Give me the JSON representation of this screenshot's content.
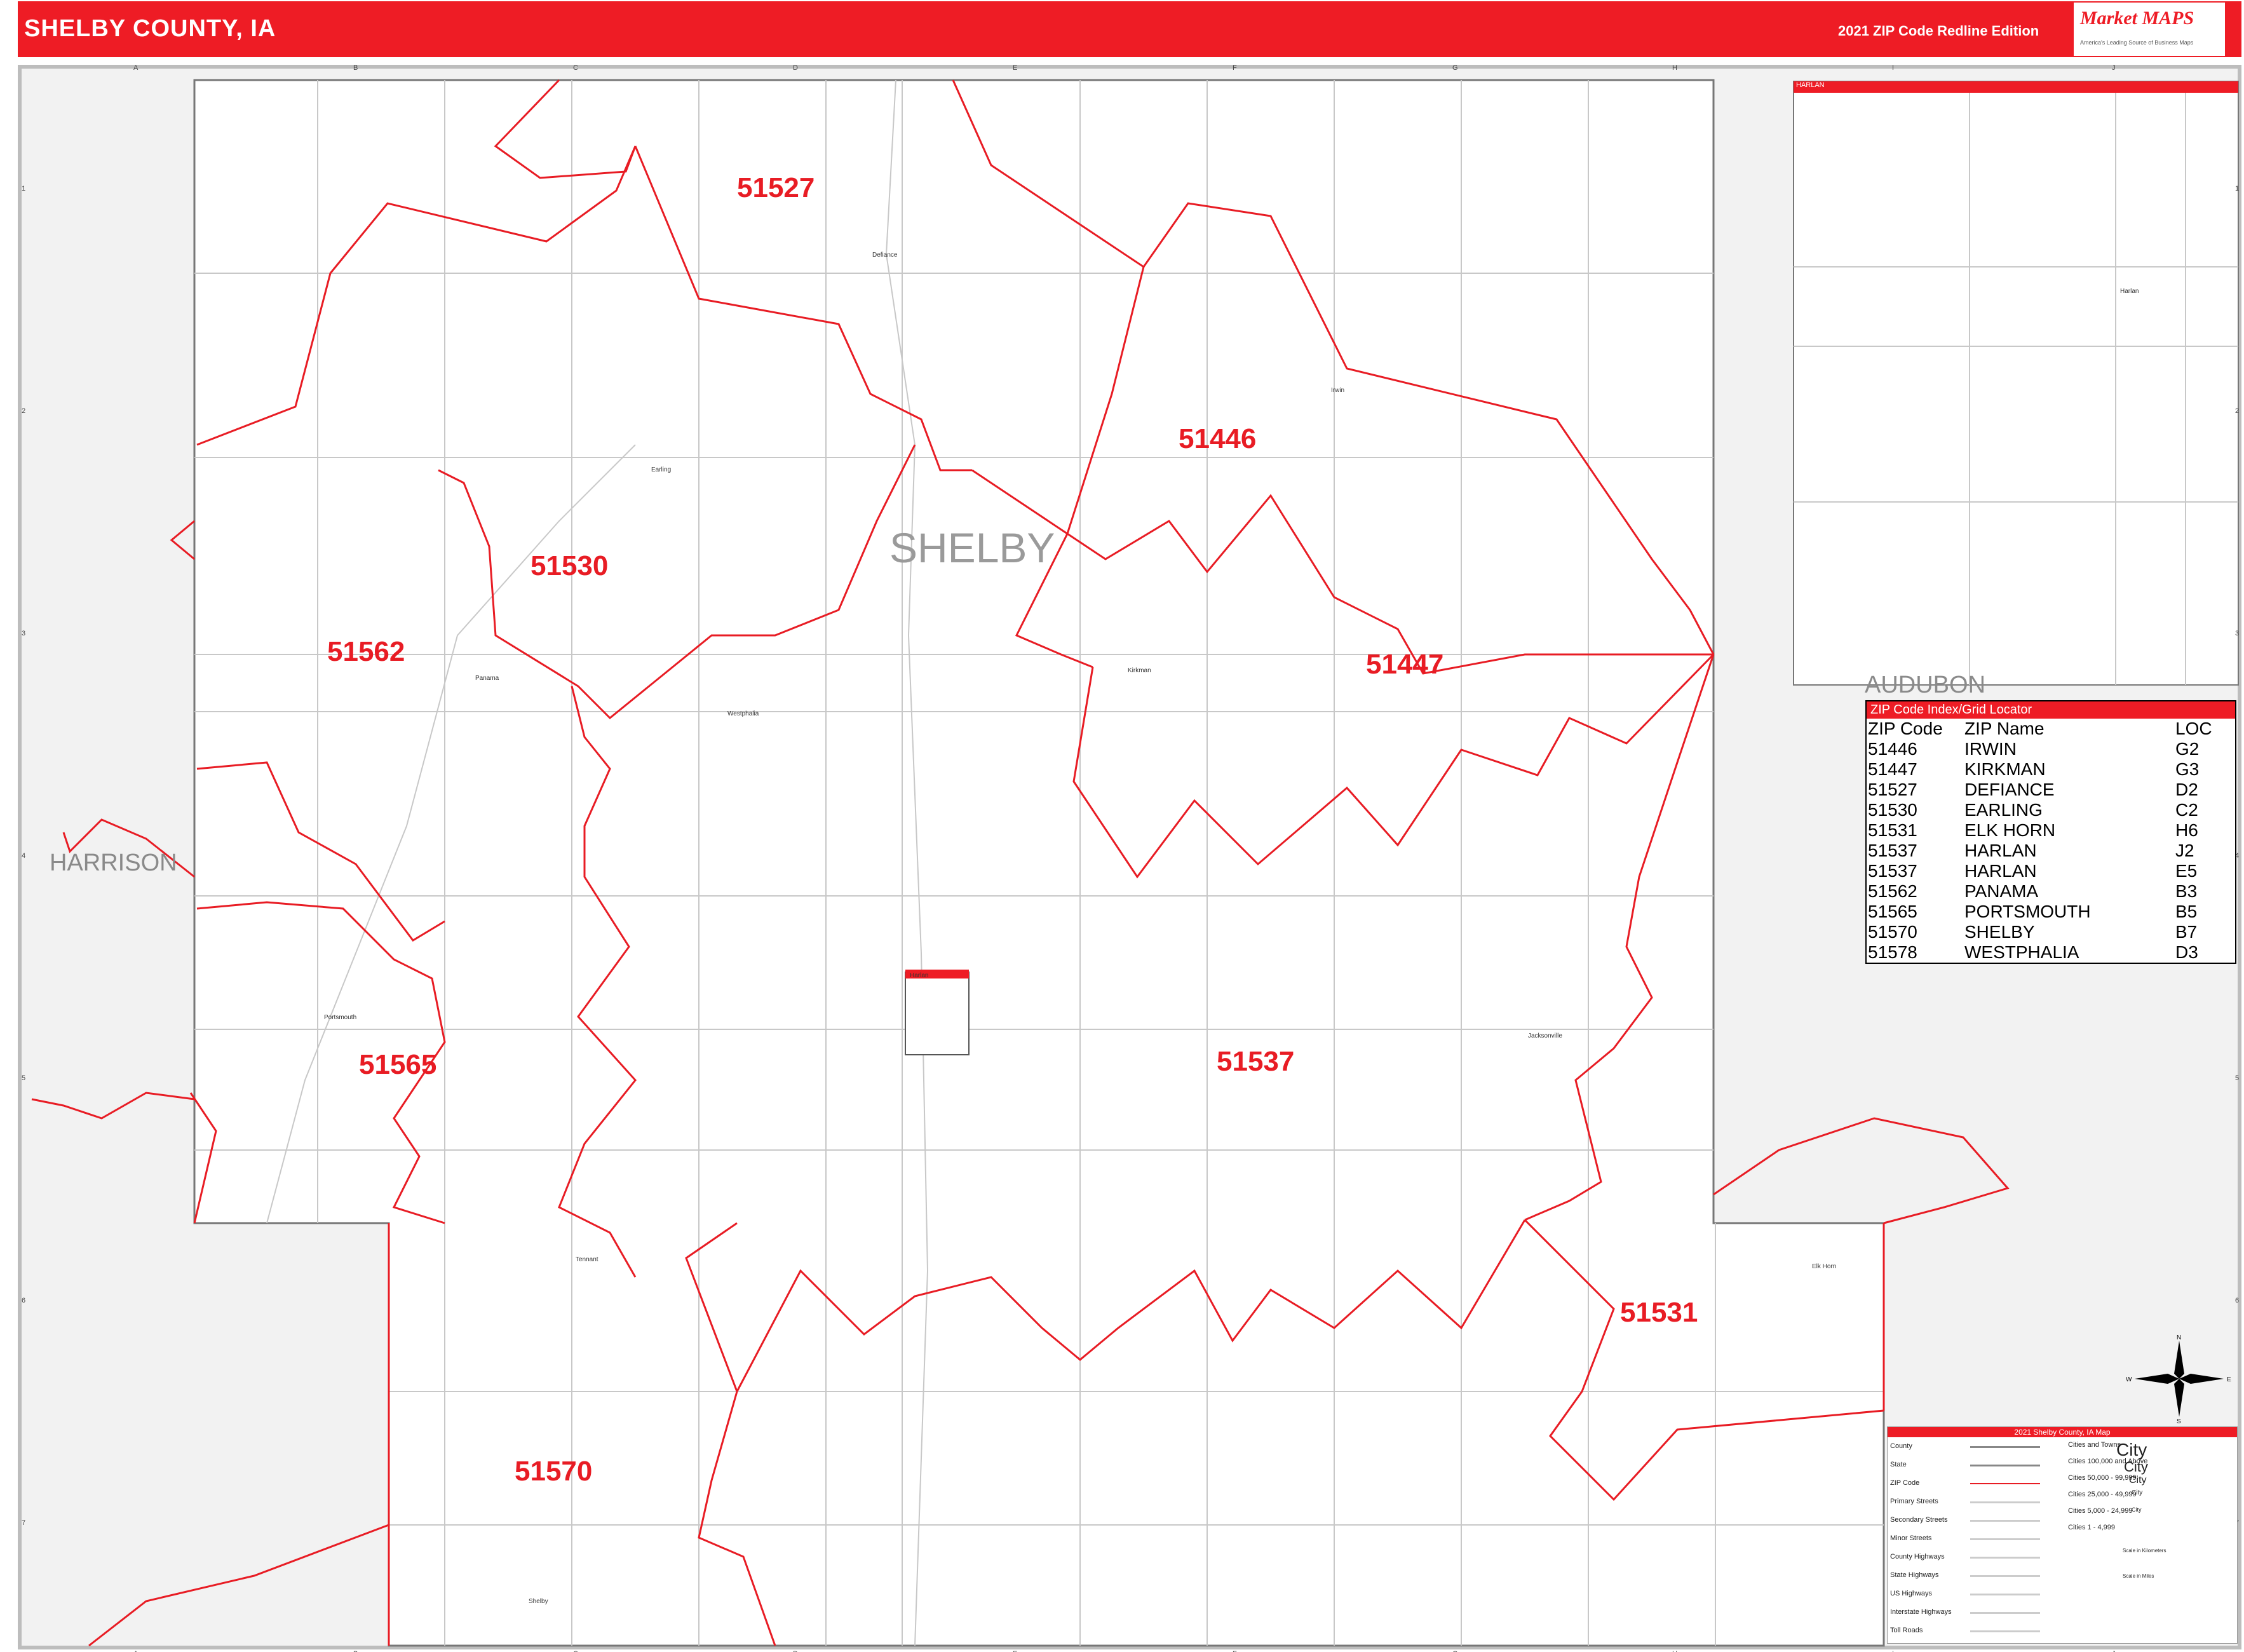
{
  "header": {
    "title": "SHELBY COUNTY, IA",
    "edition": "2021 ZIP Code Redline Edition",
    "logo_brand": "Market MAPS",
    "logo_tagline": "America's Leading Source of Business Maps"
  },
  "grid": {
    "columns": [
      "A",
      "B",
      "C",
      "D",
      "E",
      "F",
      "G",
      "H",
      "I",
      "J"
    ],
    "rows": [
      "1",
      "2",
      "3",
      "4",
      "5",
      "6",
      "7"
    ]
  },
  "county_label": "SHELBY",
  "neighbors": {
    "west": "HARRISON",
    "east": "AUDUBON"
  },
  "zip_labels": [
    "51527",
    "51446",
    "51530",
    "51562",
    "51447",
    "51565",
    "51537",
    "51531",
    "51570"
  ],
  "towns": [
    "Defiance",
    "Earling",
    "Irwin",
    "Panama",
    "Westphalia",
    "Kirkman",
    "Portsmouth",
    "Harlan",
    "Jacksonville",
    "Tennant",
    "Elk Horn",
    "Shelby"
  ],
  "inset": {
    "title": "HARLAN",
    "town": "Harlan"
  },
  "zip_index": {
    "title": "ZIP Code Index/Grid Locator",
    "headers": [
      "ZIP Code",
      "ZIP Name",
      "LOC"
    ],
    "rows": [
      [
        "51446",
        "IRWIN",
        "G2"
      ],
      [
        "51447",
        "KIRKMAN",
        "G3"
      ],
      [
        "51527",
        "DEFIANCE",
        "D2"
      ],
      [
        "51530",
        "EARLING",
        "C2"
      ],
      [
        "51531",
        "ELK HORN",
        "H6"
      ],
      [
        "51537",
        "HARLAN",
        "J2"
      ],
      [
        "51537",
        "HARLAN",
        "E5"
      ],
      [
        "51562",
        "PANAMA",
        "B3"
      ],
      [
        "51565",
        "PORTSMOUTH",
        "B5"
      ],
      [
        "51570",
        "SHELBY",
        "B7"
      ],
      [
        "51578",
        "WESTPHALIA",
        "D3"
      ]
    ]
  },
  "legend": {
    "title": "2021 Shelby County, IA Map",
    "left_items": [
      "County",
      "State",
      "ZIP Code",
      "Primary Streets",
      "Secondary Streets",
      "Minor Streets",
      "County Highways",
      "State Highways",
      "US Highways",
      "Interstate Highways",
      "Toll Roads"
    ],
    "right_items": [
      "Cities and Towns",
      "Cities 100,000 and Above",
      "Cities 50,000 - 99,999",
      "Cities 25,000 - 49,999",
      "Cities 5,000 - 24,999",
      "Cities 1 - 4,999"
    ],
    "city_samples": [
      "City",
      "City",
      "City",
      "City",
      "City"
    ],
    "scale_km": "Scale in Kilometers",
    "scale_mi": "Scale in Miles"
  },
  "compass": {
    "n": "N",
    "s": "S",
    "e": "E",
    "w": "W"
  },
  "colors": {
    "accent": "#ee1c25",
    "zip_line": "#e81c24",
    "road": "#bdbdbd"
  }
}
